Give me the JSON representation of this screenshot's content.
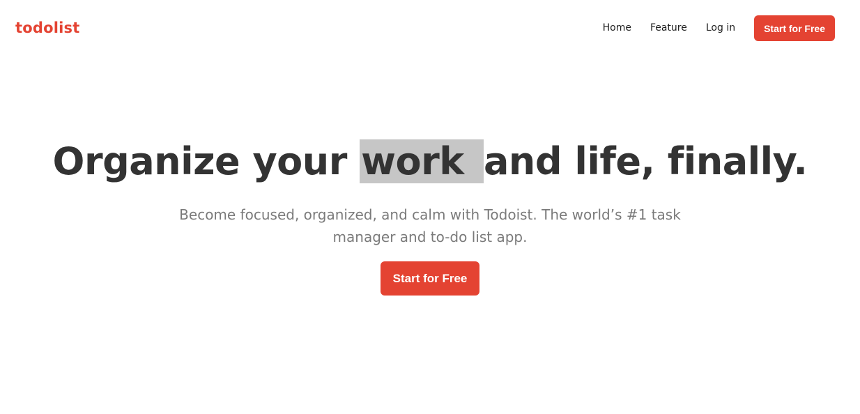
{
  "brand": {
    "name": "todolist",
    "color": "#e44332"
  },
  "nav": {
    "items": [
      {
        "label": "Home"
      },
      {
        "label": "Feature"
      },
      {
        "label": "Log in"
      }
    ],
    "cta_label": "Start for Free"
  },
  "hero": {
    "title_before": "Organize your ",
    "title_highlight": "work ",
    "title_after": "and life, finally.",
    "subtitle": "Become focused, organized, and calm with Todoist. The world’s #1 task manager and to-do list app.",
    "cta_label": "Start for Free"
  },
  "colors": {
    "accent": "#e44332",
    "highlight": "#c6c6c6",
    "heading": "#333333",
    "subtext": "#7a7a7a"
  }
}
